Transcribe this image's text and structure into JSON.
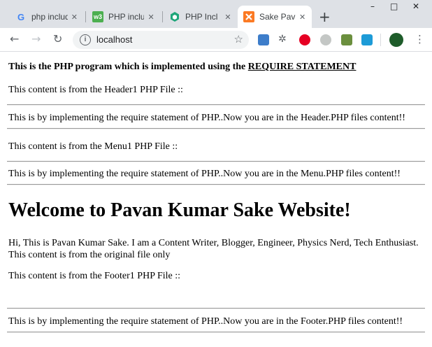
{
  "tabs": [
    {
      "label": "php includ",
      "icon": "google-icon"
    },
    {
      "label": "PHP inclu",
      "icon": "w3schools-icon"
    },
    {
      "label": "PHP Incl",
      "icon": "hexagon-icon"
    },
    {
      "label": "Sake Pava",
      "icon": "xampp-icon"
    }
  ],
  "address_bar": {
    "url": "localhost"
  },
  "window_controls": {
    "minimize": "–",
    "maximize": "□",
    "close": "✕"
  },
  "content": {
    "intro_prefix": "This is the PHP program which is implemented using the ",
    "intro_link": "REQUIRE STATEMENT",
    "header_title": "This content is from the Header1 PHP File ::",
    "header_body": "This is by implementing the require statement of PHP..Now you are in the Header.PHP files content!!",
    "menu_title": "This content is from the Menu1 PHP File ::",
    "menu_body": "This is by implementing the require statement of PHP..Now you are in the Menu.PHP files content!!",
    "welcome_heading": "Welcome to Pavan Kumar Sake Website!",
    "bio": "Hi, This is Pavan Kumar Sake. I am a Content Writer, Blogger, Engineer, Physics Nerd, Tech Enthusiast. This content is from the original file only",
    "footer_title": "This content is from the Footer1 PHP File ::",
    "footer_body": "This is by implementing the require statement of PHP..Now you are in the Footer.PHP files content!!"
  },
  "colors": {
    "tab_strip": "#dee1e6",
    "omnibox": "#f1f3f4",
    "link": "#000000"
  }
}
